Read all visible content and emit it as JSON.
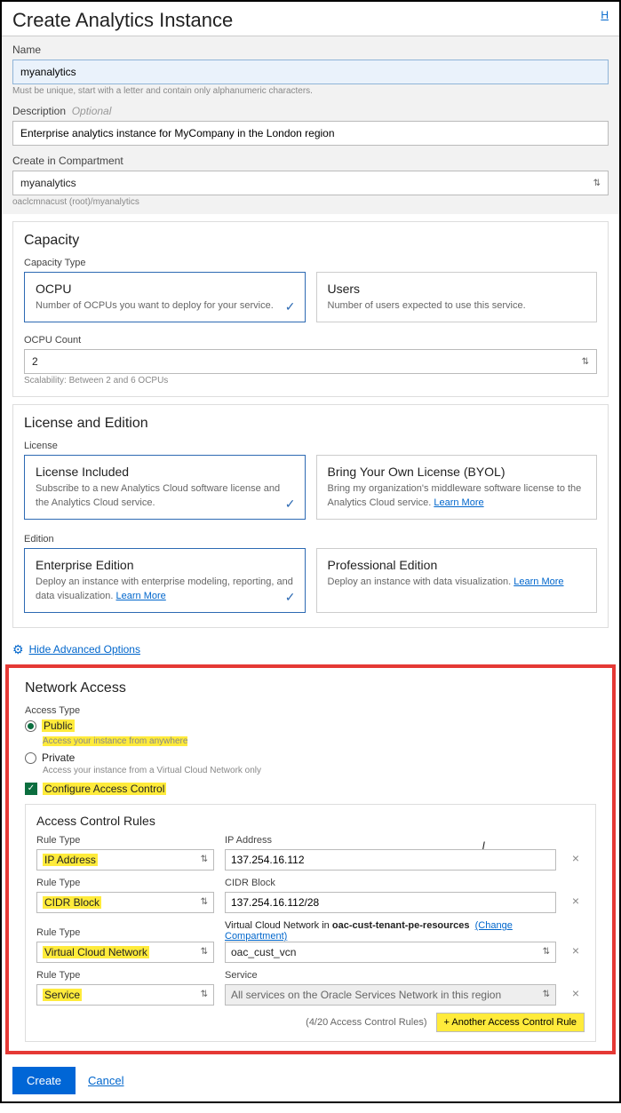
{
  "header": {
    "title": "Create Analytics Instance",
    "help": "H"
  },
  "name": {
    "label": "Name",
    "value": "myanalytics",
    "hint": "Must be unique, start with a letter and contain only alphanumeric characters."
  },
  "description": {
    "label": "Description",
    "optional": "Optional",
    "value": "Enterprise analytics instance for MyCompany in the London region"
  },
  "compartment": {
    "label": "Create in Compartment",
    "value": "myanalytics",
    "path": "oaclcmnacust (root)/myanalytics"
  },
  "capacity": {
    "title": "Capacity",
    "typeLabel": "Capacity Type",
    "ocpu": {
      "title": "OCPU",
      "desc": "Number of OCPUs you want to deploy for your service."
    },
    "users": {
      "title": "Users",
      "desc": "Number of users expected to use this service."
    },
    "countLabel": "OCPU Count",
    "countValue": "2",
    "countHint": "Scalability: Between 2 and 6 OCPUs"
  },
  "license": {
    "title": "License and Edition",
    "licenseLabel": "License",
    "included": {
      "title": "License Included",
      "desc": "Subscribe to a new Analytics Cloud software license and the Analytics Cloud service."
    },
    "byol": {
      "title": "Bring Your Own License (BYOL)",
      "desc": "Bring my organization's middleware software license to the Analytics Cloud service.",
      "learn": "Learn More"
    },
    "editionLabel": "Edition",
    "enterprise": {
      "title": "Enterprise Edition",
      "desc": "Deploy an instance with enterprise modeling, reporting, and data visualization.",
      "learn": "Learn More"
    },
    "professional": {
      "title": "Professional Edition",
      "desc": "Deploy an instance with data visualization.",
      "learn": "Learn More"
    }
  },
  "advOptions": "Hide Advanced Options",
  "network": {
    "title": "Network Access",
    "accessTypeLabel": "Access Type",
    "public": "Public",
    "publicHint": "Access your instance from anywhere",
    "private": "Private",
    "privateHint": "Access your instance from a Virtual Cloud Network only",
    "configure": "Configure Access Control"
  },
  "acr": {
    "title": "Access Control Rules",
    "rules": [
      {
        "typeLabel": "Rule Type",
        "type": "IP Address",
        "valLabel": "IP Address",
        "val": "137.254.16.112"
      },
      {
        "typeLabel": "Rule Type",
        "type": "CIDR Block",
        "valLabel": "CIDR Block",
        "val": "137.254.16.112/28"
      },
      {
        "typeLabel": "Rule Type",
        "type": "Virtual Cloud Network",
        "valLabel": "Virtual Cloud Network in",
        "compartment": "oac-cust-tenant-pe-resources",
        "change": "(Change Compartment)",
        "val": "oac_cust_vcn"
      },
      {
        "typeLabel": "Rule Type",
        "type": "Service",
        "valLabel": "Service",
        "val": "All services on the Oracle Services Network in this region"
      }
    ],
    "count": "(4/20 Access Control Rules)",
    "addBtn": "+ Another Access Control Rule"
  },
  "footer": {
    "create": "Create",
    "cancel": "Cancel"
  }
}
